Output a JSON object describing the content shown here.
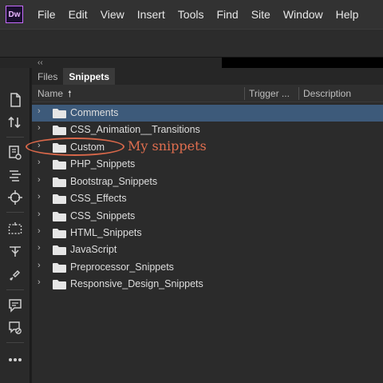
{
  "app": {
    "logo": "Dw"
  },
  "menu": [
    "File",
    "Edit",
    "View",
    "Insert",
    "Tools",
    "Find",
    "Site",
    "Window",
    "Help"
  ],
  "collapse": {
    "label": "‹‹"
  },
  "tools": [
    "new-document-icon",
    "file-transfer-icon",
    "live-view-icon",
    "dom-icon",
    "target-icon",
    "marquee-select-icon",
    "extract-icon",
    "brush-icon",
    "comment-icon",
    "comment-settings-icon",
    "more-icon"
  ],
  "panel": {
    "tabs": [
      {
        "label": "Files",
        "active": false
      },
      {
        "label": "Snippets",
        "active": true
      }
    ],
    "columns": {
      "name": "Name",
      "sort": "🠕",
      "trigger": "Trigger ...",
      "description": "Description"
    },
    "folders": [
      {
        "label": "Comments",
        "selected": true
      },
      {
        "label": "CSS_Animation__Transitions",
        "selected": false
      },
      {
        "label": "Custom",
        "selected": false
      },
      {
        "label": "PHP_Snippets",
        "selected": false
      },
      {
        "label": "Bootstrap_Snippets",
        "selected": false
      },
      {
        "label": "CSS_Effects",
        "selected": false
      },
      {
        "label": "CSS_Snippets",
        "selected": false
      },
      {
        "label": "HTML_Snippets",
        "selected": false
      },
      {
        "label": "JavaScript",
        "selected": false
      },
      {
        "label": "Preprocessor_Snippets",
        "selected": false
      },
      {
        "label": "Responsive_Design_Snippets",
        "selected": false
      }
    ]
  },
  "annotation": {
    "text": "My snippets",
    "color": "#e06e4f"
  },
  "colors": {
    "selection": "#3d5a7a",
    "logo_accent": "#c56bff"
  }
}
